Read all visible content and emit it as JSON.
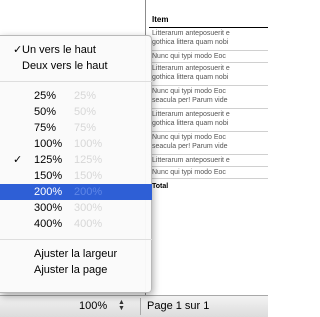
{
  "document": {
    "header": "Item",
    "rows": [
      {
        "lines": [
          "Litterarum anteposuerit e",
          "gothica littera quam nobi"
        ]
      },
      {
        "lines": [
          "Nunc qui typi modo Eoc"
        ]
      },
      {
        "lines": [
          "Litterarum anteposuerit e",
          "gothica littera quam nobi"
        ]
      },
      {
        "lines": [
          "Nunc qui typi modo Eoc",
          "seacula per! Parum vide"
        ]
      },
      {
        "lines": [
          "Litterarum anteposuerit e",
          "gothica littera quam nobi"
        ]
      },
      {
        "lines": [
          "Nunc qui typi modo Eoc",
          "seacula per! Parum vide"
        ]
      },
      {
        "lines": [
          "Litterarum anteposuerit e"
        ]
      },
      {
        "lines": [
          "Nunc qui typi modo Eoc"
        ]
      }
    ],
    "total_label": "Total"
  },
  "zoom_menu": {
    "items": [
      {
        "label": "Un vers le haut",
        "checked": true
      },
      {
        "label": "Deux vers le haut",
        "checked": false
      },
      {
        "label": "25%",
        "ghost": "25%"
      },
      {
        "label": "50%",
        "ghost": "50%"
      },
      {
        "label": "75%",
        "ghost": "75%"
      },
      {
        "label": "100%",
        "ghost": "100%"
      },
      {
        "label": "125%",
        "ghost": "125%",
        "checked": true
      },
      {
        "label": "150%",
        "ghost": "150%"
      },
      {
        "label": "200%",
        "ghost": "200%",
        "selected": true
      },
      {
        "label": "300%",
        "ghost": "300%"
      },
      {
        "label": "400%",
        "ghost": "400%"
      },
      {
        "label": "Ajuster la largeur"
      },
      {
        "label": "Ajuster la page"
      }
    ],
    "check_mark": "✓",
    "selected_color": "#2e5fd6"
  },
  "statusbar": {
    "zoom_value": "100%",
    "page_indicator": "Page 1 sur 1"
  }
}
